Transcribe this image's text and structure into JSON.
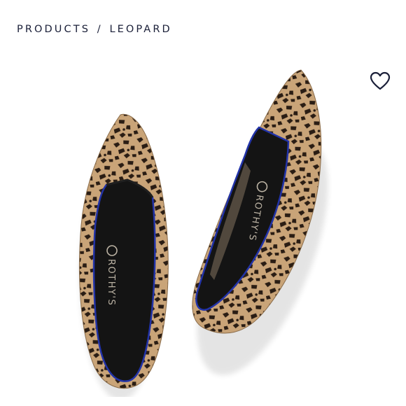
{
  "breadcrumb": {
    "category": "PRODUCTS",
    "separator": "/",
    "current": "LEOPARD"
  },
  "product": {
    "brand_imprint": "ROTHY'S",
    "favorite_icon": "heart-outline-icon"
  },
  "colors": {
    "text": "#1a1f38",
    "knit_base": "#c9a478",
    "spots": "#2a1d14",
    "insole": "#141414",
    "piping": "#2233a8"
  }
}
